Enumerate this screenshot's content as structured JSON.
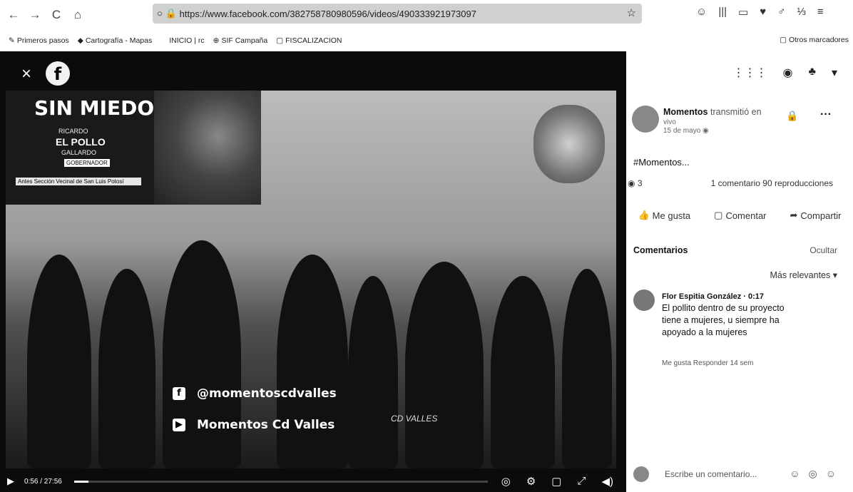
{
  "browser": {
    "url": "https://www.facebook.com/382758780980596/videos/490333921973097",
    "back_icon": "←",
    "forward_icon": "→",
    "reload_icon": "C",
    "home_icon": "⌂",
    "star_icon": "☆",
    "ext_icons": [
      "☺",
      "|||",
      "▭",
      "♥",
      "♂",
      "⅓",
      "≡"
    ]
  },
  "bookmarks": [
    {
      "icon": "✎",
      "label": "Primeros pasos"
    },
    {
      "icon": "◆",
      "label": "Cartografía - Mapas"
    },
    {
      "icon": "",
      "label": "INICIO | rc"
    },
    {
      "icon": "⊕",
      "label": "SIF Campaña"
    },
    {
      "icon": "▢",
      "label": "FISCALIZACION"
    }
  ],
  "bookmarks_other": "Otros marcadores",
  "video": {
    "close_label": "×",
    "logo_letter": "f",
    "banner": {
      "headline": "SIN MIEDO",
      "line1": "RICARDO",
      "line2": "EL POLLO",
      "line3": "GALLARDO",
      "badge": "GOBERNADOR",
      "footer": "Antes Sección Vecinal de San Luis Potosí"
    },
    "overlay_facebook": "@momentoscdvalles",
    "overlay_youtube": "Momentos Cd Valles",
    "watermark": "CD VALLES",
    "time": "0:56 / 27:56",
    "progress_fraction": 0.034,
    "play_icon": "▶",
    "ctrl_icons": [
      "◎",
      "⚙",
      "▢",
      "⤢",
      "◀)"
    ]
  },
  "sidebar": {
    "top_icons": [
      "⋮⋮⋮",
      "◉",
      "♣",
      "▾"
    ],
    "post": {
      "author": "Momentos",
      "author_suffix": "transmitió en",
      "live_text": "vivo",
      "date": "15 de mayo",
      "lock_icon": "🔒",
      "more": "···",
      "text": "#Momentos..."
    },
    "stats": {
      "reactions": "3",
      "counts": "1 comentario  90 reproducciones"
    },
    "actions": {
      "like": "Me gusta",
      "comment": "Comentar",
      "share": "Compartir"
    },
    "comments_header": "Comentarios",
    "hide_label": "Ocultar",
    "sort_label": "Más relevantes ▾",
    "comment": {
      "author": "Flor Espitia González · 0:17",
      "text": "El pollito dentro de su proyecto tiene a mujeres, u siempre ha apoyado a la mujeres",
      "actions": "Me gusta  Responder  14 sem"
    },
    "composer_placeholder": "Escribe un comentario...",
    "composer_icons": [
      "☺",
      "◎",
      "☺"
    ]
  }
}
